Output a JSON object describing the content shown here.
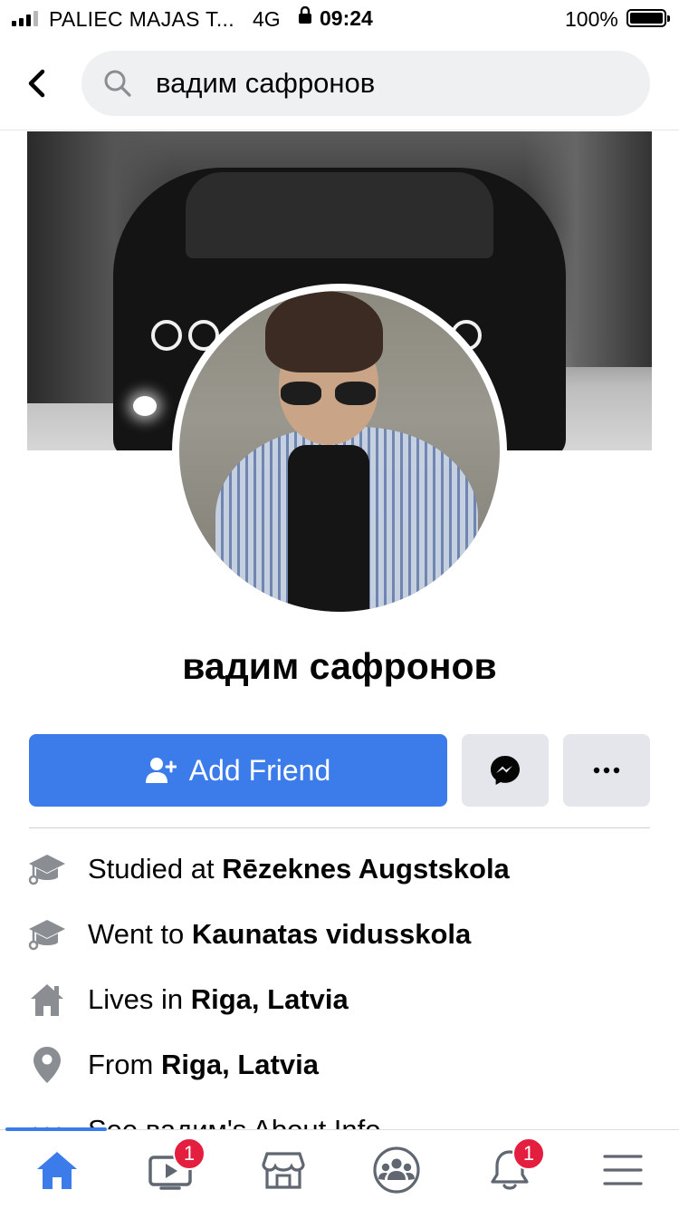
{
  "status_bar": {
    "carrier": "PALIEC MAJAS T...",
    "network": "4G",
    "time": "09:24",
    "battery": "100%",
    "icons": [
      "signal-icon",
      "lock-icon",
      "battery-icon"
    ]
  },
  "header": {
    "back_icon": "chevron-left-icon",
    "search_icon": "search-icon",
    "search_value": "вадим сафронов"
  },
  "profile": {
    "name": "вадим сафронов",
    "cover_image": "black car on snowy forest road",
    "profile_image": "young man in sunglasses and checked shirt"
  },
  "actions": {
    "add_friend_label": "Add Friend",
    "add_friend_icon": "add-person-icon",
    "messenger_icon": "messenger-icon",
    "more_icon": "more-dots-icon",
    "accent_color": "#3b7cea"
  },
  "info": {
    "studied_prefix": "Studied at ",
    "studied_value": "Rēzeknes Augstskola",
    "went_prefix": "Went to ",
    "went_value": "Kaunatas vidusskola",
    "lives_prefix": "Lives in ",
    "lives_value": "Riga, Latvia",
    "from_prefix": "From ",
    "from_value": "Riga, Latvia",
    "about_link": "See вадим's About Info"
  },
  "tabbar": {
    "tabs": [
      {
        "icon": "home-icon",
        "badge": ""
      },
      {
        "icon": "watch-video-icon",
        "badge": "1"
      },
      {
        "icon": "marketplace-icon",
        "badge": ""
      },
      {
        "icon": "groups-icon",
        "badge": ""
      },
      {
        "icon": "notifications-bell-icon",
        "badge": "1"
      },
      {
        "icon": "menu-icon",
        "badge": ""
      }
    ],
    "active_color": "#3b7cea",
    "badge_color": "#e41e3f"
  }
}
